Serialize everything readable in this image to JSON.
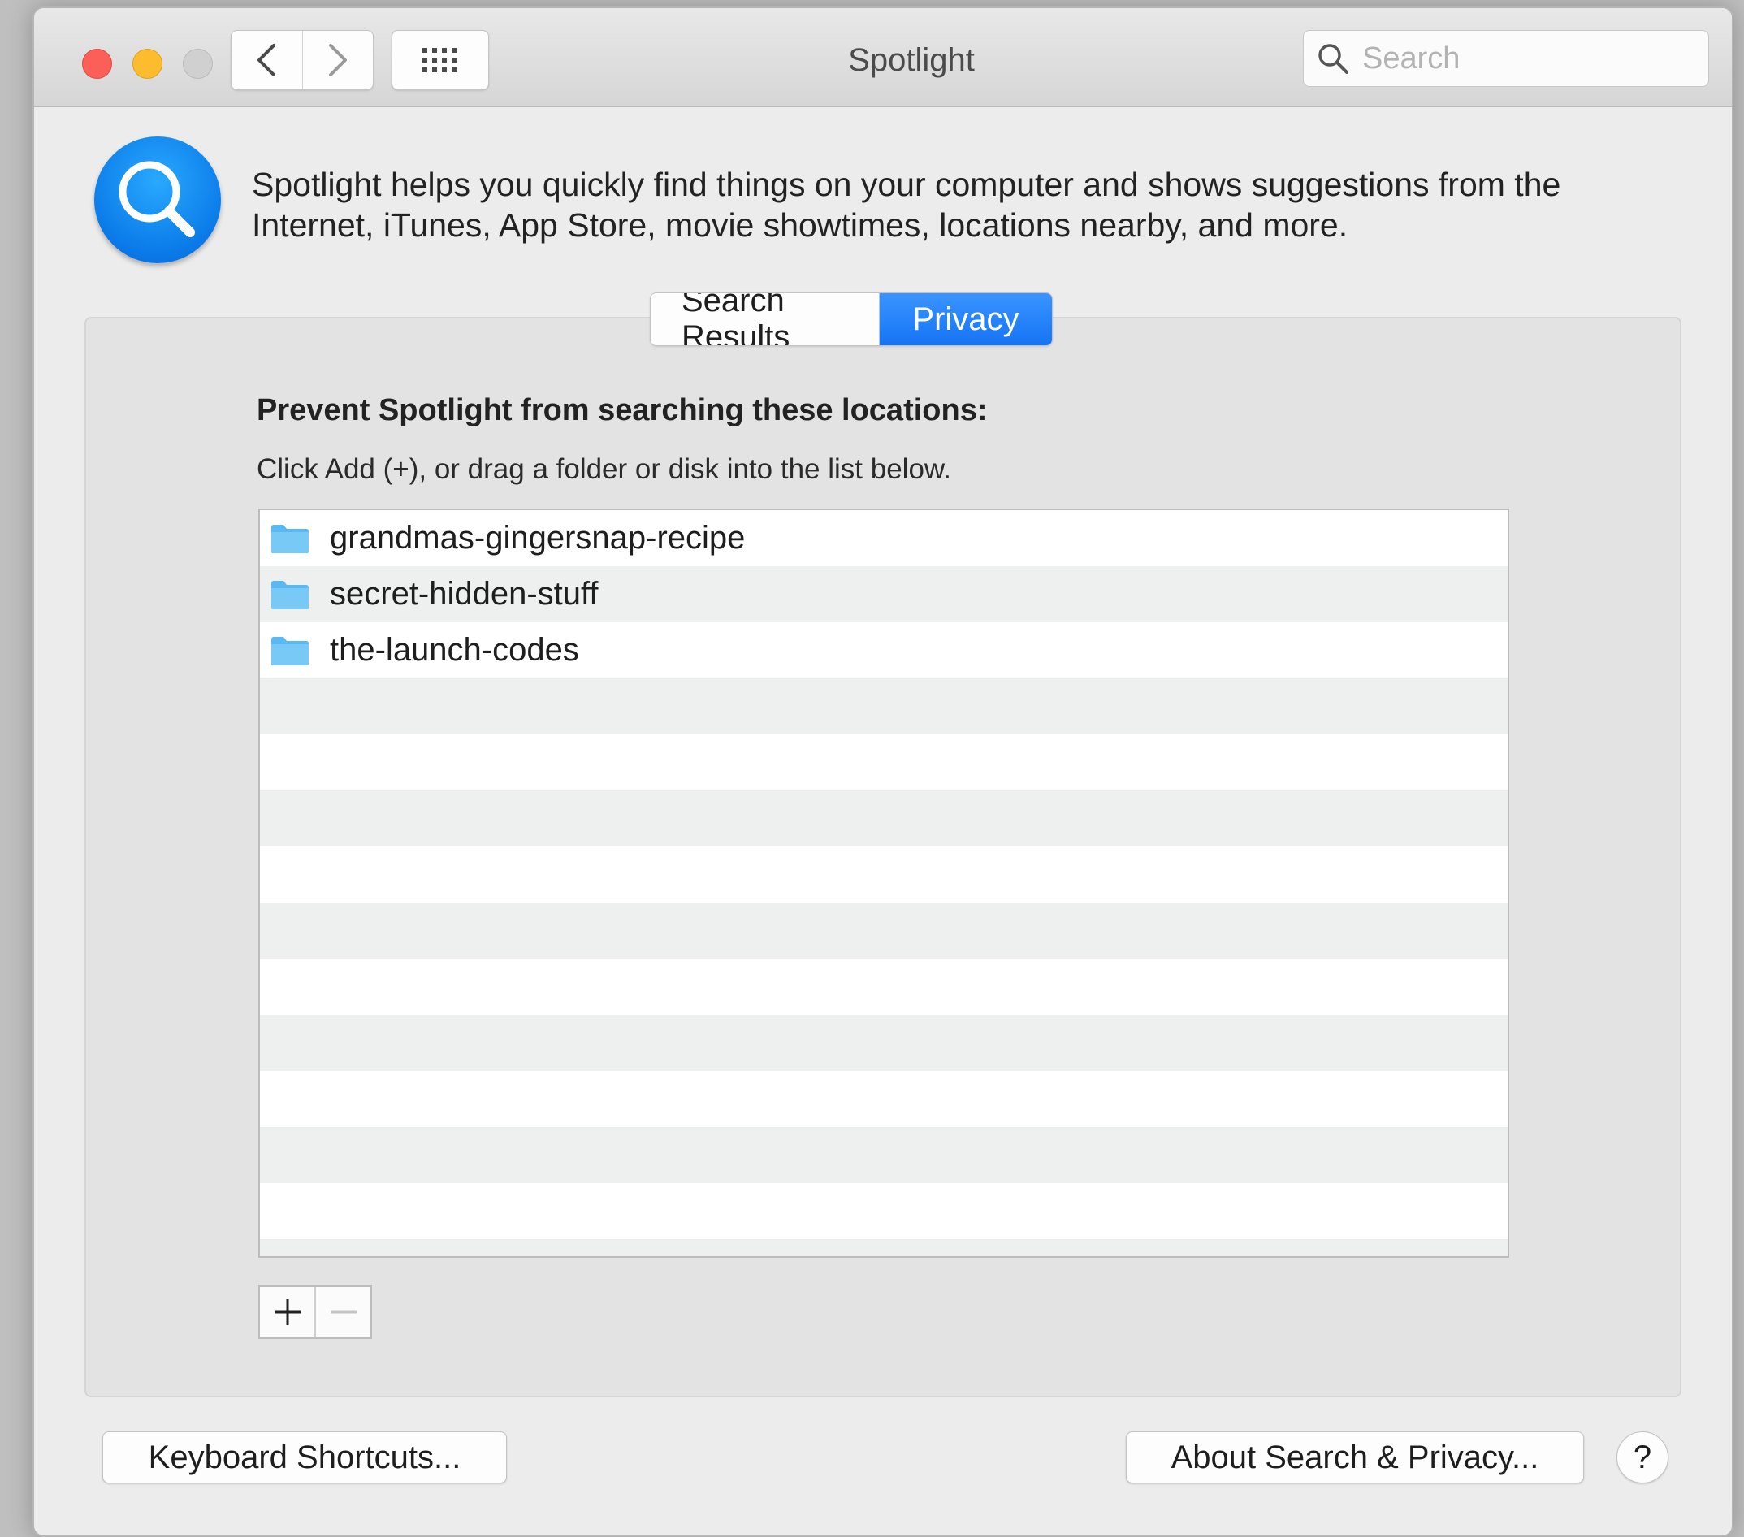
{
  "window": {
    "title": "Spotlight",
    "search_placeholder": "Search"
  },
  "description": "Spotlight helps you quickly find things on your computer and shows suggestions from the Internet, iTunes, App Store, movie showtimes, locations nearby, and more.",
  "tabs": [
    {
      "label": "Search Results",
      "active": false
    },
    {
      "label": "Privacy",
      "active": true
    }
  ],
  "privacy": {
    "heading": "Prevent Spotlight from searching these locations:",
    "instructions": "Click Add (+), or drag a folder or disk into the list below.",
    "locations": [
      {
        "name": "grandmas-gingersnap-recipe",
        "icon": "folder-icon"
      },
      {
        "name": "secret-hidden-stuff",
        "icon": "folder-icon"
      },
      {
        "name": "the-launch-codes",
        "icon": "folder-icon"
      }
    ]
  },
  "footer": {
    "keyboard_shortcuts_label": "Keyboard Shortcuts...",
    "about_label": "About Search & Privacy...",
    "help_label": "?"
  },
  "colors": {
    "accent": "#1574f5",
    "folder": "#5ab9f2",
    "close": "#fc5f57",
    "minimize": "#fdbc2e",
    "zoom_disabled": "#d0d0d0"
  }
}
